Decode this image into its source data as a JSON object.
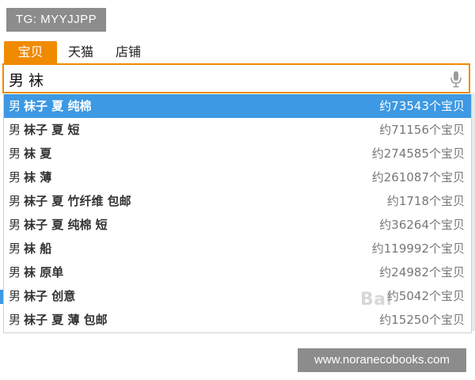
{
  "overlay": {
    "tg_label": "TG: MYYJJPP",
    "url_label": "www.noranecobooks.com",
    "watermark": "Bai"
  },
  "tabs": [
    {
      "label": "宝贝",
      "active": true
    },
    {
      "label": "天猫",
      "active": false
    },
    {
      "label": "店铺",
      "active": false
    }
  ],
  "search": {
    "value": "男 袜",
    "mic_icon": "microphone-icon"
  },
  "suggestions": [
    {
      "head": "男",
      "tail": "袜子 夏 纯棉",
      "count": "约73543个宝贝",
      "selected": true
    },
    {
      "head": "男",
      "tail": "袜子 夏 短",
      "count": "约71156个宝贝",
      "selected": false
    },
    {
      "head": "男",
      "tail": "袜 夏",
      "count": "约274585个宝贝",
      "selected": false
    },
    {
      "head": "男",
      "tail": "袜 薄",
      "count": "约261087个宝贝",
      "selected": false
    },
    {
      "head": "男",
      "tail": "袜子 夏 竹纤维 包邮",
      "count": "约1718个宝贝",
      "selected": false
    },
    {
      "head": "男",
      "tail": "袜子 夏 纯棉 短",
      "count": "约36264个宝贝",
      "selected": false
    },
    {
      "head": "男",
      "tail": "袜 船",
      "count": "约119992个宝贝",
      "selected": false
    },
    {
      "head": "男",
      "tail": "袜 原单",
      "count": "约24982个宝贝",
      "selected": false
    },
    {
      "head": "男",
      "tail": "袜子 创意",
      "count": "约5042个宝贝",
      "selected": false
    },
    {
      "head": "男",
      "tail": "袜子 夏 薄 包邮",
      "count": "约15250个宝贝",
      "selected": false
    }
  ],
  "colors": {
    "accent": "#f08a00",
    "selected_row": "#3d99e3"
  }
}
